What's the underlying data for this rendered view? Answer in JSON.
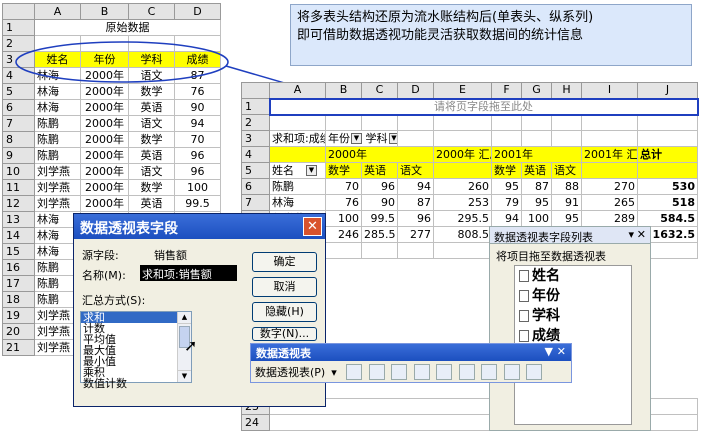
{
  "note": {
    "line1": "将多表头结构还原为流水账结构后(单表头、纵系列)",
    "line2": "即可借助数据透视功能灵活获取数据间的统计信息"
  },
  "left_sheet": {
    "columns": [
      "A",
      "B",
      "C",
      "D"
    ],
    "title": "原始数据",
    "headers": [
      "姓名",
      "年份",
      "学科",
      "成绩"
    ],
    "rows": [
      [
        "林海",
        "2000年",
        "语文",
        "87"
      ],
      [
        "林海",
        "2000年",
        "数学",
        "76"
      ],
      [
        "林海",
        "2000年",
        "英语",
        "90"
      ],
      [
        "陈鹏",
        "2000年",
        "语文",
        "94"
      ],
      [
        "陈鹏",
        "2000年",
        "数学",
        "70"
      ],
      [
        "陈鹏",
        "2000年",
        "英语",
        "96"
      ],
      [
        "刘学燕",
        "2000年",
        "语文",
        "96"
      ],
      [
        "刘学燕",
        "2000年",
        "数学",
        "100"
      ],
      [
        "刘学燕",
        "2000年",
        "英语",
        "99.5"
      ],
      [
        "林海",
        "",
        "",
        ""
      ],
      [
        "林海",
        "",
        "",
        ""
      ],
      [
        "林海",
        "",
        "",
        ""
      ],
      [
        "陈鹏",
        "",
        "",
        ""
      ],
      [
        "陈鹏",
        "",
        "",
        ""
      ],
      [
        "陈鹏",
        "",
        "",
        ""
      ],
      [
        "刘学燕",
        "",
        "",
        ""
      ],
      [
        "刘学燕",
        "",
        "",
        ""
      ],
      [
        "刘学燕",
        "",
        "",
        ""
      ]
    ]
  },
  "pivot_sheet": {
    "columns": [
      "A",
      "B",
      "C",
      "D",
      "E",
      "F",
      "G",
      "H",
      "I",
      "J"
    ],
    "drop_page": "请将页字段拖至此处",
    "data_field": "求和项:成绩",
    "year_btn": "年份",
    "subject_btn": "学科",
    "y2000": "2000年",
    "y2000_total": "2000年 汇总",
    "y2001": "2001年",
    "y2001_total": "2001年 汇总",
    "grand_total": "总计",
    "name_btn": "姓名",
    "subjects": [
      "数学",
      "英语",
      "语文"
    ],
    "rows": [
      [
        "陈鹏",
        "70",
        "96",
        "94",
        "260",
        "95",
        "87",
        "88",
        "270",
        "530"
      ],
      [
        "林海",
        "76",
        "90",
        "87",
        "253",
        "79",
        "95",
        "91",
        "265",
        "518"
      ],
      [
        "刘学燕",
        "100",
        "99.5",
        "96",
        "295.5",
        "94",
        "100",
        "95",
        "289",
        "584.5"
      ],
      [
        "总计",
        "246",
        "285.5",
        "277",
        "808.5",
        "268",
        "282",
        "274",
        "824",
        "1632.5"
      ]
    ]
  },
  "dialog": {
    "title": "数据透视表字段",
    "source_label": "源字段:",
    "source_value": "销售额",
    "name_label": "名称(M):",
    "name_value": "求和项:销售额",
    "summary_label": "汇总方式(S):",
    "options": [
      "求和",
      "计数",
      "平均值",
      "最大值",
      "最小值",
      "乘积",
      "数值计数"
    ],
    "ok": "确定",
    "cancel": "取消",
    "hide": "隐藏(H)",
    "number": "数字(N)..."
  },
  "pivot_toolbar": {
    "title": "数据透视表",
    "menu": "数据透视表(P)"
  },
  "field_list": {
    "title": "数据透视表字段列表",
    "hint": "将项目拖至数据透视表",
    "fields": [
      "姓名",
      "年份",
      "学科",
      "成绩"
    ]
  }
}
